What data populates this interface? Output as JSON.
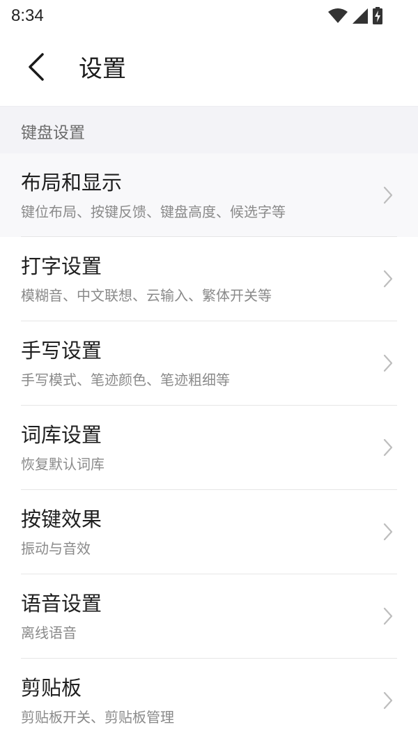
{
  "status_bar": {
    "time": "8:34",
    "icons": [
      "wifi-icon",
      "signal-icon",
      "battery-charging-icon"
    ]
  },
  "header": {
    "back_icon": "chevron-left-icon",
    "title": "设置"
  },
  "section": {
    "label": "键盘设置"
  },
  "items": [
    {
      "title": "布局和显示",
      "desc": "键位布局、按键反馈、键盘高度、候选字等"
    },
    {
      "title": "打字设置",
      "desc": "模糊音、中文联想、云输入、繁体开关等"
    },
    {
      "title": "手写设置",
      "desc": "手写模式、笔迹颜色、笔迹粗细等"
    },
    {
      "title": "词库设置",
      "desc": "恢复默认词库"
    },
    {
      "title": "按键效果",
      "desc": "振动与音效"
    },
    {
      "title": "语音设置",
      "desc": "离线语音"
    },
    {
      "title": "剪贴板",
      "desc": "剪贴板开关、剪贴板管理"
    }
  ],
  "colors": {
    "section_bg": "#f3f3f7",
    "title_text": "#1f1f1f",
    "desc_text": "#8a8a8a",
    "chevron": "#bdbdbd"
  }
}
